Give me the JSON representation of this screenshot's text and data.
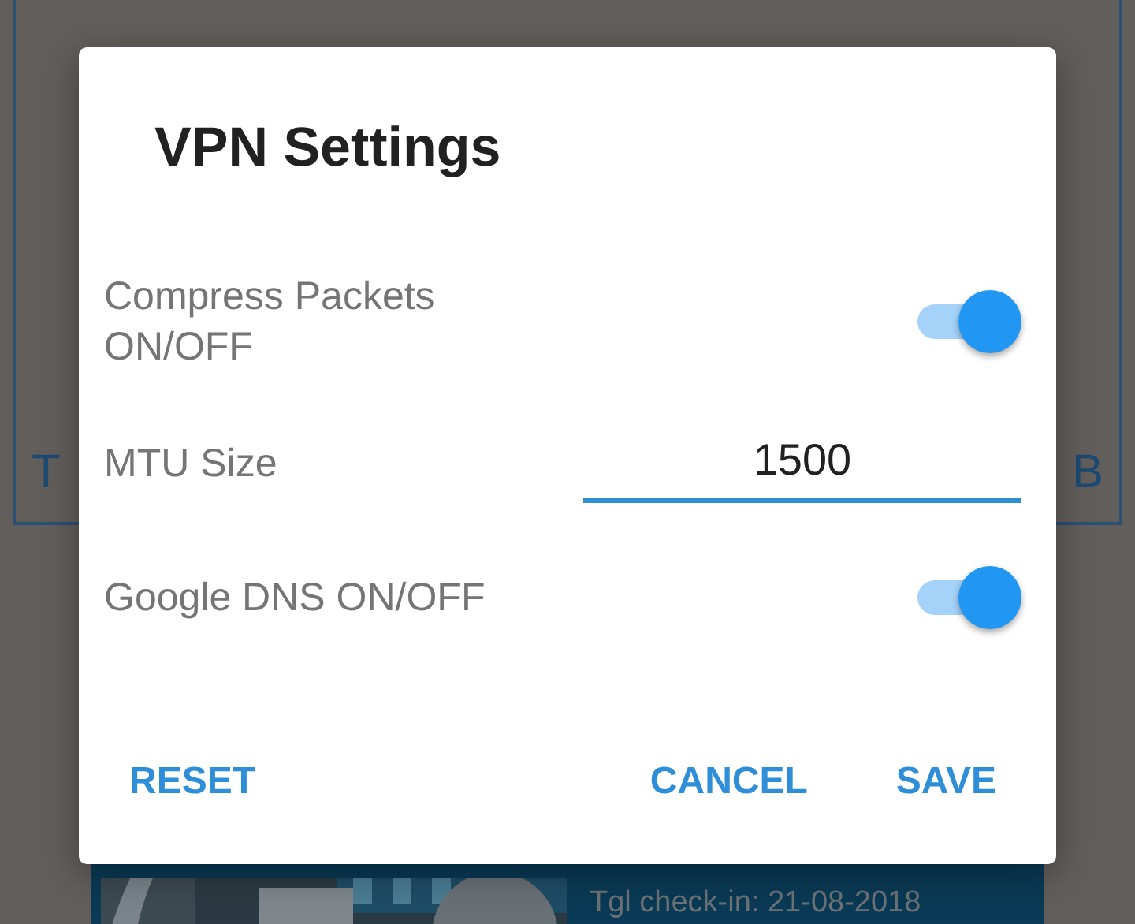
{
  "background": {
    "left_text": "T",
    "right_text": "B",
    "card": {
      "subtitle": "Tgl check-in: 21-08-2018"
    }
  },
  "dialog": {
    "title": "VPN Settings",
    "rows": [
      {
        "kind": "switch",
        "label": "Compress Packets ON/OFF",
        "on": true
      },
      {
        "kind": "input",
        "label": "MTU Size",
        "value": "1500"
      },
      {
        "kind": "switch",
        "label": "Google DNS ON/OFF",
        "on": true
      }
    ],
    "buttons": [
      {
        "label": "RESET"
      },
      {
        "label": "CANCEL"
      },
      {
        "label": "SAVE"
      }
    ]
  }
}
